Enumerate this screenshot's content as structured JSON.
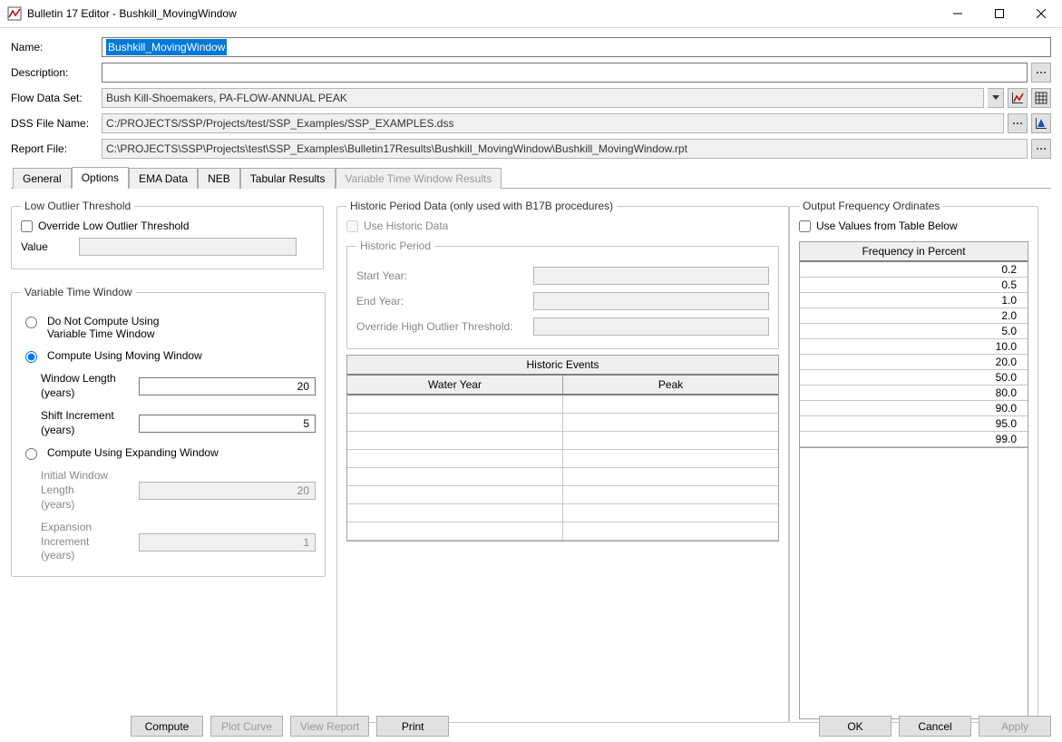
{
  "window": {
    "title": "Bulletin 17 Editor - Bushkill_MovingWindow"
  },
  "fields": {
    "name_label": "Name:",
    "name_value": "Bushkill_MovingWindow",
    "desc_label": "Description:",
    "desc_value": "",
    "flow_label": "Flow Data Set:",
    "flow_value": "Bush Kill-Shoemakers, PA-FLOW-ANNUAL PEAK",
    "dss_label": "DSS File Name:",
    "dss_value": "C:/PROJECTS/SSP/Projects/test/SSP_Examples/SSP_EXAMPLES.dss",
    "rpt_label": "Report File:",
    "rpt_value": "C:\\PROJECTS\\SSP\\Projects\\test\\SSP_Examples\\Bulletin17Results\\Bushkill_MovingWindow\\Bushkill_MovingWindow.rpt"
  },
  "tabs": {
    "general": "General",
    "options": "Options",
    "ema": "EMA Data",
    "neb": "NEB",
    "tabular": "Tabular Results",
    "varwin": "Variable Time Window Results"
  },
  "low_outlier": {
    "legend": "Low Outlier Threshold",
    "override": "Override Low Outlier Threshold",
    "value_label": "Value"
  },
  "varwin": {
    "legend": "Variable Time Window",
    "r1a": "Do Not Compute Using",
    "r1b": "Variable Time Window",
    "r2": "Compute Using Moving Window",
    "wl_a": "Window Length",
    "wl_b": "(years)",
    "wl_val": "20",
    "si_a": "Shift Increment",
    "si_b": "(years)",
    "si_val": "5",
    "r3": "Compute Using Expanding Window",
    "iw_a": "Initial Window Length",
    "iw_b": "(years)",
    "iw_val": "20",
    "ei_a": "Expansion Increment",
    "ei_b": "(years)",
    "ei_val": "1"
  },
  "hist": {
    "legend_outer": "Historic Period Data (only used with B17B procedures)",
    "use_hist": "Use Historic Data",
    "legend_inner": "Historic Period",
    "start": "Start Year:",
    "end": "End Year:",
    "override": "Override High Outlier Threshold:",
    "events_hdr": "Historic Events",
    "col_year": "Water Year",
    "col_peak": "Peak"
  },
  "freq": {
    "legend": "Output Frequency Ordinates",
    "use_table": "Use Values from Table Below",
    "header": "Frequency in Percent",
    "values": [
      "0.2",
      "0.5",
      "1.0",
      "2.0",
      "5.0",
      "10.0",
      "20.0",
      "50.0",
      "80.0",
      "90.0",
      "95.0",
      "99.0"
    ]
  },
  "buttons": {
    "compute": "Compute",
    "plot": "Plot Curve",
    "view": "View Report",
    "print": "Print",
    "ok": "OK",
    "cancel": "Cancel",
    "apply": "Apply"
  }
}
